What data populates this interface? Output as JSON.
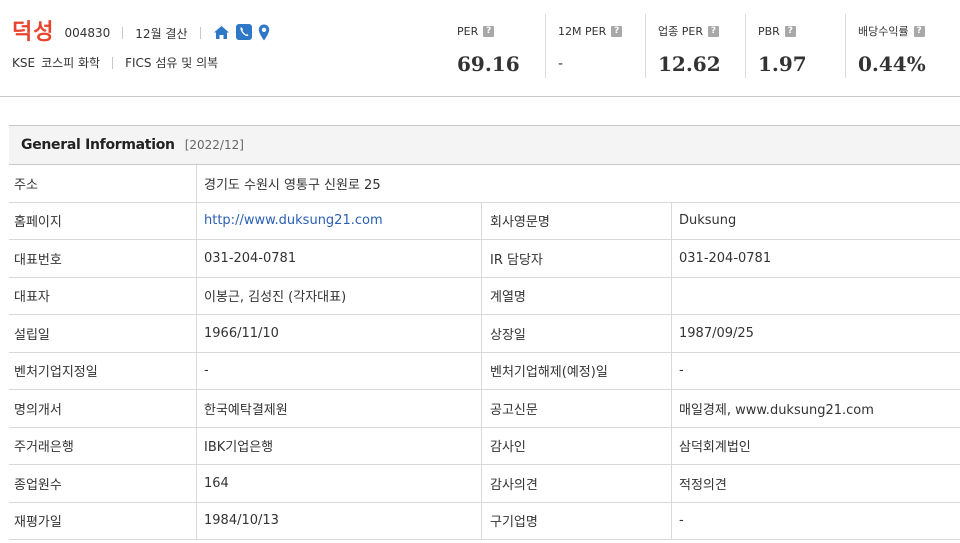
{
  "header": {
    "corp_name": "덕성",
    "corp_code": "004830",
    "settlement": "12월 결산",
    "market": "KSE",
    "index": "코스피 화학",
    "fics": "FICS 섬유 및 의복",
    "icons": [
      "home-icon",
      "phone-icon",
      "location-pin-icon"
    ],
    "accent_color": "#e8442d",
    "icon_color": "#2e78c7"
  },
  "metrics": [
    {
      "label": "PER",
      "value": "69.16"
    },
    {
      "label": "12M PER",
      "value": "-"
    },
    {
      "label": "업종 PER",
      "value": "12.62"
    },
    {
      "label": "PBR",
      "value": "1.97"
    },
    {
      "label": "배당수익률",
      "value": "0.44%"
    }
  ],
  "help_glyph": "?",
  "general": {
    "title": "General Information",
    "date": "[2022/12]",
    "address": {
      "label": "주소",
      "value": "경기도 수원시 영통구 신원로 25"
    },
    "rows": [
      [
        {
          "label": "홈페이지",
          "value": "http://www.duksung21.com"
        },
        {
          "label": "회사영문명",
          "value": "Duksung"
        }
      ],
      [
        {
          "label": "대표번호",
          "value": "031-204-0781"
        },
        {
          "label": "IR 담당자",
          "value": "031-204-0781"
        }
      ],
      [
        {
          "label": "대표자",
          "value": "이봉근, 김성진 (각자대표)"
        },
        {
          "label": "계열명",
          "value": ""
        }
      ],
      [
        {
          "label": "설립일",
          "value": "1966/11/10"
        },
        {
          "label": "상장일",
          "value": "1987/09/25"
        }
      ],
      [
        {
          "label": "벤처기업지정일",
          "value": "-"
        },
        {
          "label": "벤처기업해제(예정)일",
          "value": "-"
        }
      ],
      [
        {
          "label": "명의개서",
          "value": "한국예탁결제원"
        },
        {
          "label": "공고신문",
          "value": "매일경제, www.duksung21.com"
        }
      ],
      [
        {
          "label": "주거래은행",
          "value": "IBK기업은행"
        },
        {
          "label": "감사인",
          "value": "삼덕회계법인"
        }
      ],
      [
        {
          "label": "종업원수",
          "value": "164"
        },
        {
          "label": "감사의견",
          "value": "적정의견"
        }
      ],
      [
        {
          "label": "재평가일",
          "value": "1984/10/13"
        },
        {
          "label": "구기업명",
          "value": "-"
        }
      ]
    ]
  }
}
